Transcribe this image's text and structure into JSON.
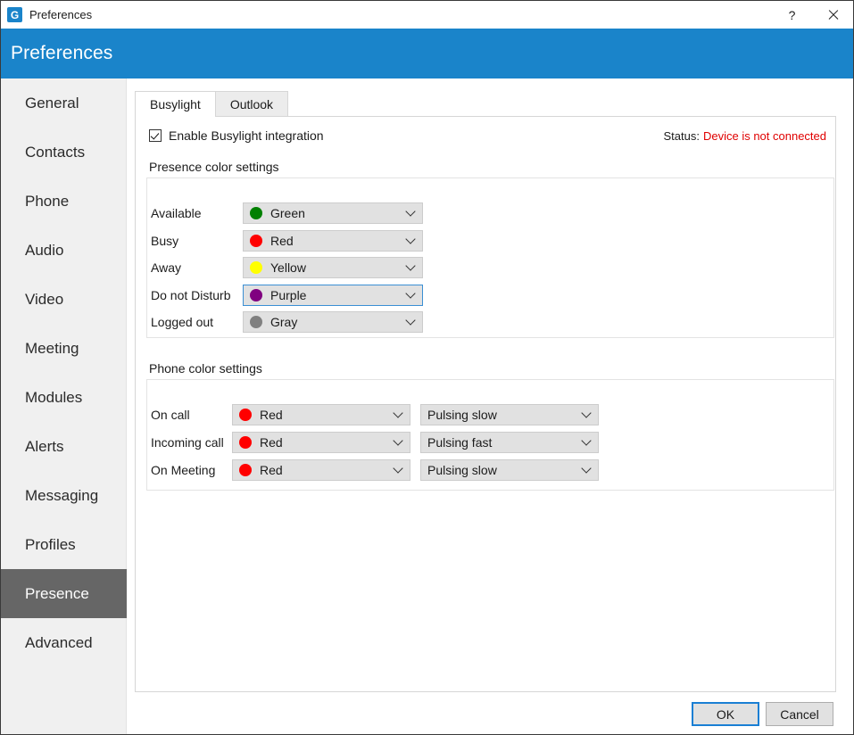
{
  "window": {
    "title": "Preferences",
    "app_icon": "app-logo-icon",
    "help_label": "?",
    "close_label": "close-icon",
    "header_title": "Preferences",
    "header_color": "#1a84ca"
  },
  "sidebar": {
    "items": [
      {
        "label": "General",
        "selected": false
      },
      {
        "label": "Contacts",
        "selected": false
      },
      {
        "label": "Phone",
        "selected": false
      },
      {
        "label": "Audio",
        "selected": false
      },
      {
        "label": "Video",
        "selected": false
      },
      {
        "label": "Meeting",
        "selected": false
      },
      {
        "label": "Modules",
        "selected": false
      },
      {
        "label": "Alerts",
        "selected": false
      },
      {
        "label": "Messaging",
        "selected": false
      },
      {
        "label": "Profiles",
        "selected": false
      },
      {
        "label": "Presence",
        "selected": true
      },
      {
        "label": "Advanced",
        "selected": false
      }
    ],
    "selected_color": "#666666"
  },
  "tabs": [
    {
      "label": "Busylight",
      "active": true
    },
    {
      "label": "Outlook",
      "active": false
    }
  ],
  "enable": {
    "label": "Enable Busylight integration",
    "checked": true
  },
  "status": {
    "label": "Status:",
    "value": "Device is not connected",
    "value_color": "#e00000"
  },
  "presence_settings": {
    "caption": "Presence color settings",
    "rows": [
      {
        "label": "Available",
        "color_label": "Green",
        "color": "#008000",
        "focused": false
      },
      {
        "label": "Busy",
        "color_label": "Red",
        "color": "#ff0000",
        "focused": false
      },
      {
        "label": "Away",
        "color_label": "Yellow",
        "color": "#ffff00",
        "focused": false
      },
      {
        "label": "Do not Disturb",
        "color_label": "Purple",
        "color": "#800080",
        "focused": true
      },
      {
        "label": "Logged out",
        "color_label": "Gray",
        "color": "#808080",
        "focused": false
      }
    ]
  },
  "phone_settings": {
    "caption": "Phone color settings",
    "rows": [
      {
        "label": "On call",
        "color_label": "Red",
        "color": "#ff0000",
        "effect_label": "Pulsing slow"
      },
      {
        "label": "Incoming call",
        "color_label": "Red",
        "color": "#ff0000",
        "effect_label": "Pulsing fast"
      },
      {
        "label": "On Meeting",
        "color_label": "Red",
        "color": "#ff0000",
        "effect_label": "Pulsing slow"
      }
    ]
  },
  "footer": {
    "ok_label": "OK",
    "cancel_label": "Cancel"
  }
}
